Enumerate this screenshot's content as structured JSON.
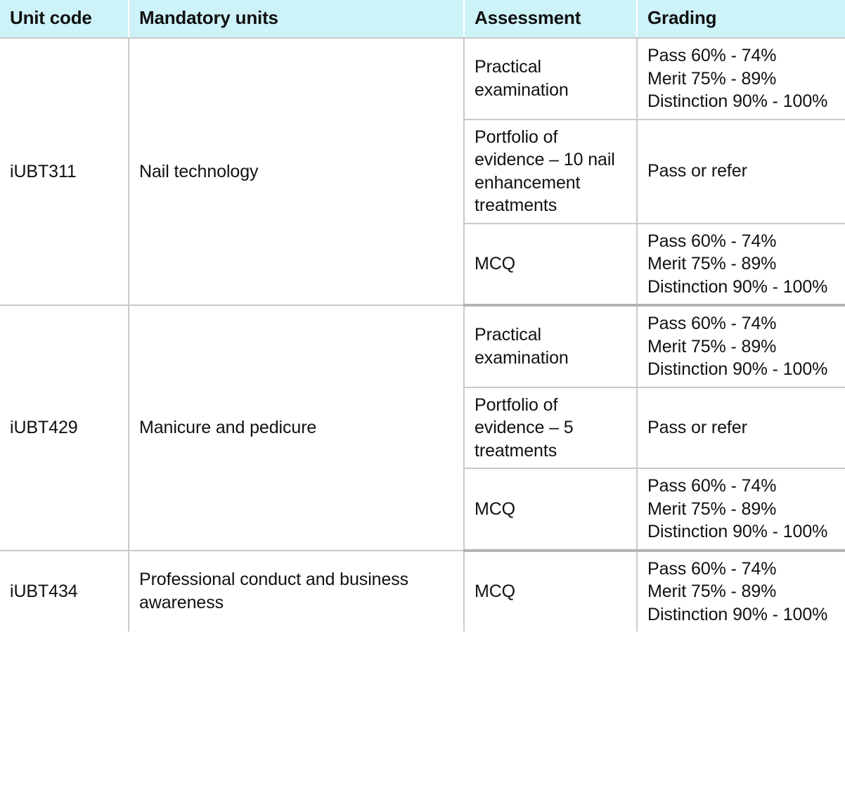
{
  "table": {
    "headers": [
      {
        "key": "unit_code",
        "label": "Unit code"
      },
      {
        "key": "mandatory_units",
        "label": "Mandatory units"
      },
      {
        "key": "assessment",
        "label": "Assessment"
      },
      {
        "key": "grading",
        "label": "Grading"
      }
    ],
    "header_background": "#cdf3f9",
    "border_color": "#c9c9c9",
    "group_border_color": "#b4b4b4",
    "groups": [
      {
        "unit_code": "iUBT311",
        "unit_name": "Nail technology",
        "rows": [
          {
            "assessment": "Practical examination",
            "grading": "Pass 60% - 74%\nMerit 75% - 89%\nDistinction 90% - 100%"
          },
          {
            "assessment": "Portfolio of evidence – 10 nail enhancement treatments",
            "grading": "Pass or refer"
          },
          {
            "assessment": "MCQ",
            "grading": "Pass 60% - 74%\nMerit 75% - 89%\nDistinction 90% - 100%"
          }
        ]
      },
      {
        "unit_code": "iUBT429",
        "unit_name": "Manicure and pedicure",
        "rows": [
          {
            "assessment": "Practical examination",
            "grading": "Pass 60% - 74%\nMerit 75% - 89%\nDistinction 90% - 100%"
          },
          {
            "assessment": "Portfolio of evidence – 5 treatments",
            "grading": "Pass or refer"
          },
          {
            "assessment": "MCQ",
            "grading": "Pass 60% - 74%\nMerit 75% - 89%\nDistinction 90% - 100%"
          }
        ]
      },
      {
        "unit_code": "iUBT434",
        "unit_name": "Professional conduct and business awareness",
        "rows": [
          {
            "assessment": "MCQ",
            "grading": "Pass 60% - 74%\nMerit 75% - 89%\nDistinction 90% - 100%"
          }
        ]
      }
    ]
  }
}
